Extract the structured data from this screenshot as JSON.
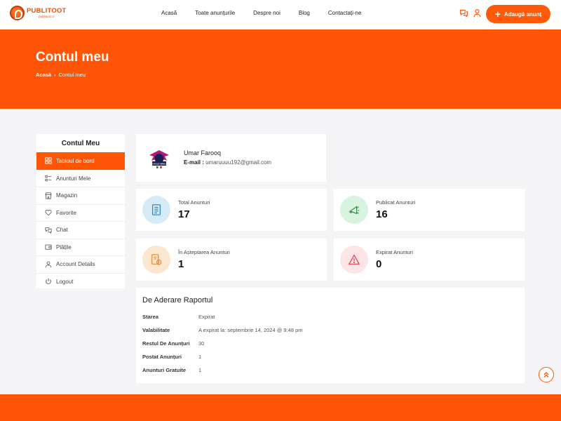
{
  "brand": {
    "name": "PUBLITOOT",
    "tagline": "publitoot.ro"
  },
  "nav": [
    "Acasă",
    "Toate anunțurile",
    "Despre noi",
    "Blog",
    "Contactați-ne"
  ],
  "header": {
    "add_button": "Adaugă anunț"
  },
  "hero": {
    "title": "Contul meu",
    "breadcrumb_home": "Acasă",
    "breadcrumb_sep": "›",
    "breadcrumb_current": "Contul meu"
  },
  "sidebar": {
    "title": "Contul Meu",
    "items": [
      {
        "label": "Tabloul de bord",
        "icon": "dashboard-icon"
      },
      {
        "label": "Anunturi Mele",
        "icon": "list-icon"
      },
      {
        "label": "Magazin",
        "icon": "store-icon"
      },
      {
        "label": "Favorite",
        "icon": "heart-icon"
      },
      {
        "label": "Chat",
        "icon": "chat-icon"
      },
      {
        "label": "Plățile",
        "icon": "wallet-icon"
      },
      {
        "label": "Account Details",
        "icon": "user-icon"
      },
      {
        "label": "Logout",
        "icon": "power-icon"
      }
    ]
  },
  "profile": {
    "name": "Umar Farooq",
    "email_label": "E-mail :",
    "email": "umaruuuu192@gmail.com",
    "avatar_text": "EAGLE WING"
  },
  "stats": [
    {
      "label": "Total Anunturi",
      "value": "17",
      "icon": "document-icon"
    },
    {
      "label": "Publicat Anunturi",
      "value": "16",
      "icon": "megaphone-icon"
    },
    {
      "label": "În Așteptarea Anunturi",
      "value": "1",
      "icon": "pending-icon"
    },
    {
      "label": "Expirat Anunturi",
      "value": "0",
      "icon": "warning-icon"
    }
  ],
  "report": {
    "title": "De Aderare Raportul",
    "rows": [
      {
        "key": "Starea",
        "value": "Expirat"
      },
      {
        "key": "Valabilitate",
        "value": "A expirat la: septembrie 14, 2024 @ 9:48 pm"
      },
      {
        "key": "Restul De Anunțuri",
        "value": "30"
      },
      {
        "key": "Postat Anunțuri",
        "value": "1"
      },
      {
        "key": "Anunturi Gratuite",
        "value": "1"
      }
    ]
  },
  "colors": {
    "accent": "#ff5507",
    "background": "#f4f4f6"
  }
}
